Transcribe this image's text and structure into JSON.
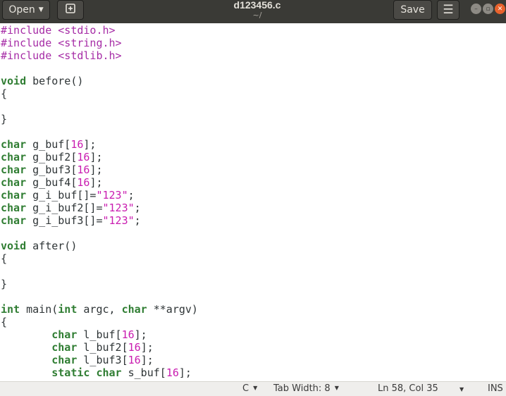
{
  "titlebar": {
    "open_label": "Open",
    "title": "d123456.c",
    "subtitle": "~/",
    "save_label": "Save"
  },
  "colors": {
    "preprocessor": "#a62ca6",
    "keyword": "#2f7d32",
    "number": "#c91cb0",
    "string": "#c91cb0",
    "text": "#2e3436",
    "titlebar_bg": "#3a3a36",
    "close_button": "#e8622c"
  },
  "editor": {
    "lines": [
      [
        {
          "t": "#include <stdio.h>",
          "c": "pp"
        }
      ],
      [
        {
          "t": "#include <string.h>",
          "c": "pp"
        }
      ],
      [
        {
          "t": "#include <stdlib.h>",
          "c": "pp"
        }
      ],
      [],
      [
        {
          "t": "void",
          "c": "kw"
        },
        {
          "t": " before()",
          "c": "plain"
        }
      ],
      [
        {
          "t": "{",
          "c": "plain"
        }
      ],
      [],
      [
        {
          "t": "}",
          "c": "plain"
        }
      ],
      [],
      [
        {
          "t": "char",
          "c": "kw"
        },
        {
          "t": " g_buf[",
          "c": "plain"
        },
        {
          "t": "16",
          "c": "num"
        },
        {
          "t": "];",
          "c": "plain"
        }
      ],
      [
        {
          "t": "char",
          "c": "kw"
        },
        {
          "t": " g_buf2[",
          "c": "plain"
        },
        {
          "t": "16",
          "c": "num"
        },
        {
          "t": "];",
          "c": "plain"
        }
      ],
      [
        {
          "t": "char",
          "c": "kw"
        },
        {
          "t": " g_buf3[",
          "c": "plain"
        },
        {
          "t": "16",
          "c": "num"
        },
        {
          "t": "];",
          "c": "plain"
        }
      ],
      [
        {
          "t": "char",
          "c": "kw"
        },
        {
          "t": " g_buf4[",
          "c": "plain"
        },
        {
          "t": "16",
          "c": "num"
        },
        {
          "t": "];",
          "c": "plain"
        }
      ],
      [
        {
          "t": "char",
          "c": "kw"
        },
        {
          "t": " g_i_buf[]=",
          "c": "plain"
        },
        {
          "t": "\"123\"",
          "c": "str"
        },
        {
          "t": ";",
          "c": "plain"
        }
      ],
      [
        {
          "t": "char",
          "c": "kw"
        },
        {
          "t": " g_i_buf2[]=",
          "c": "plain"
        },
        {
          "t": "\"123\"",
          "c": "str"
        },
        {
          "t": ";",
          "c": "plain"
        }
      ],
      [
        {
          "t": "char",
          "c": "kw"
        },
        {
          "t": " g_i_buf3[]=",
          "c": "plain"
        },
        {
          "t": "\"123\"",
          "c": "str"
        },
        {
          "t": ";",
          "c": "plain"
        }
      ],
      [],
      [
        {
          "t": "void",
          "c": "kw"
        },
        {
          "t": " after()",
          "c": "plain"
        }
      ],
      [
        {
          "t": "{",
          "c": "plain"
        }
      ],
      [],
      [
        {
          "t": "}",
          "c": "plain"
        }
      ],
      [],
      [
        {
          "t": "int",
          "c": "kw"
        },
        {
          "t": " main(",
          "c": "plain"
        },
        {
          "t": "int",
          "c": "kw"
        },
        {
          "t": " argc, ",
          "c": "plain"
        },
        {
          "t": "char",
          "c": "kw"
        },
        {
          "t": " **argv)",
          "c": "plain"
        }
      ],
      [
        {
          "t": "{",
          "c": "plain"
        }
      ],
      [
        {
          "t": "        ",
          "c": "plain"
        },
        {
          "t": "char",
          "c": "kw"
        },
        {
          "t": " l_buf[",
          "c": "plain"
        },
        {
          "t": "16",
          "c": "num"
        },
        {
          "t": "];",
          "c": "plain"
        }
      ],
      [
        {
          "t": "        ",
          "c": "plain"
        },
        {
          "t": "char",
          "c": "kw"
        },
        {
          "t": " l_buf2[",
          "c": "plain"
        },
        {
          "t": "16",
          "c": "num"
        },
        {
          "t": "];",
          "c": "plain"
        }
      ],
      [
        {
          "t": "        ",
          "c": "plain"
        },
        {
          "t": "char",
          "c": "kw"
        },
        {
          "t": " l_buf3[",
          "c": "plain"
        },
        {
          "t": "16",
          "c": "num"
        },
        {
          "t": "];",
          "c": "plain"
        }
      ],
      [
        {
          "t": "        ",
          "c": "plain"
        },
        {
          "t": "static",
          "c": "kw"
        },
        {
          "t": " ",
          "c": "plain"
        },
        {
          "t": "char",
          "c": "kw"
        },
        {
          "t": " s_buf[",
          "c": "plain"
        },
        {
          "t": "16",
          "c": "num"
        },
        {
          "t": "];",
          "c": "plain"
        }
      ]
    ]
  },
  "statusbar": {
    "language": "C",
    "tab_width": "Tab Width: 8",
    "position": "Ln 58, Col 35",
    "mode": "INS"
  },
  "icons": {
    "open_dropdown": "caret-down-icon",
    "new_tab": "new-document-icon",
    "menu": "hamburger-menu-icon",
    "minimize": "minimize-icon",
    "maximize": "maximize-icon",
    "close": "close-icon"
  }
}
